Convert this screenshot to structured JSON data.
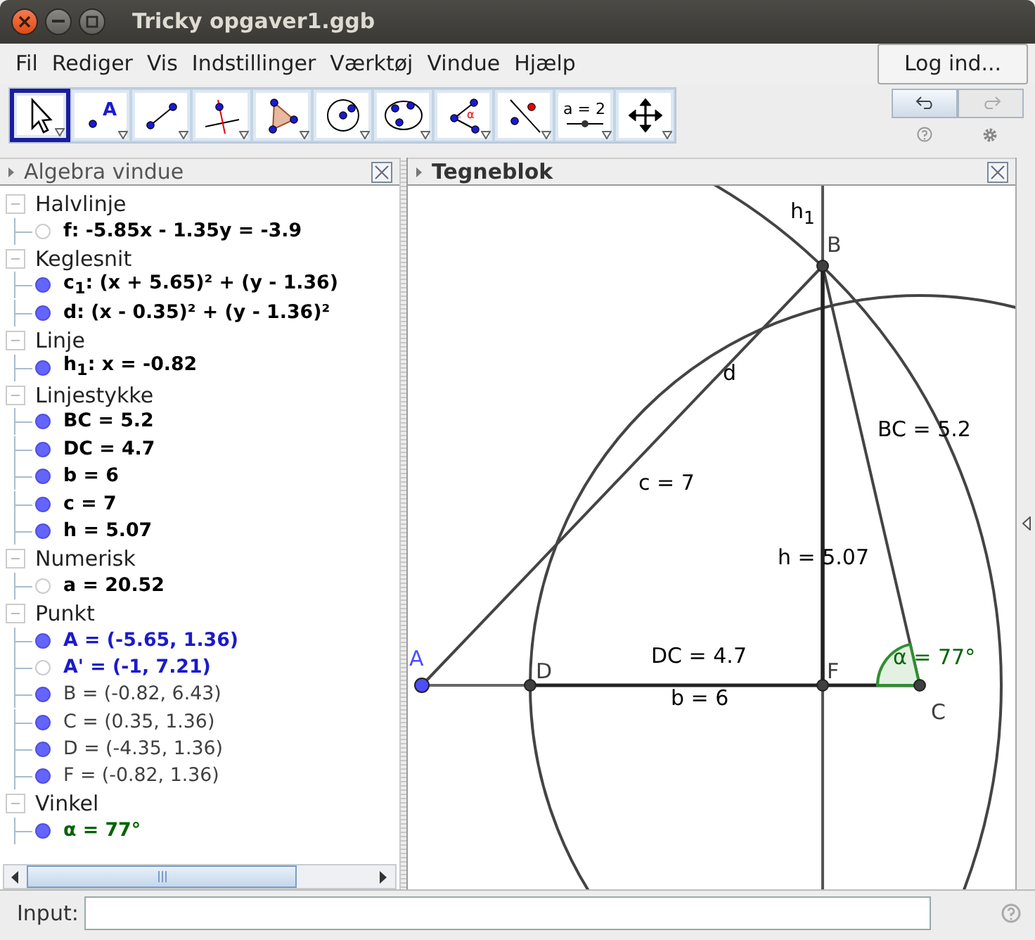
{
  "window": {
    "title": "Tricky opgaver1.ggb"
  },
  "menu": [
    "Fil",
    "Rediger",
    "Vis",
    "Indstillinger",
    "Værktøj",
    "Vindue",
    "Hjælp"
  ],
  "login": "Log ind...",
  "tools": [
    {
      "kind": "move",
      "selected": true
    },
    {
      "kind": "point",
      "selected": false,
      "text": "A"
    },
    {
      "kind": "segment",
      "selected": false
    },
    {
      "kind": "perpendicular",
      "selected": false
    },
    {
      "kind": "polygon",
      "selected": false
    },
    {
      "kind": "circle",
      "selected": false
    },
    {
      "kind": "conic",
      "selected": false
    },
    {
      "kind": "angle",
      "selected": false,
      "text": "α"
    },
    {
      "kind": "reflect",
      "selected": false
    },
    {
      "kind": "slider",
      "selected": false,
      "text": "a = 2"
    },
    {
      "kind": "move_view",
      "selected": false
    }
  ],
  "undo": {
    "disabled": false
  },
  "redo": {
    "disabled": true
  },
  "algebra": {
    "title": "Algebra vindue",
    "groups": [
      {
        "name": "Halvlinje",
        "expanded": true,
        "items": [
          {
            "text": "f: -5.85x - 1.35y = -3.9",
            "visible": false,
            "color": "#000000",
            "bold": true
          }
        ]
      },
      {
        "name": "Keglesnit",
        "expanded": true,
        "items": [
          {
            "text": "c$_{1}$: (x + 5.65)² + (y - 1.36)",
            "visible": true,
            "color": "#000000",
            "bold": true
          },
          {
            "text": "d: (x - 0.35)² + (y - 1.36)²",
            "visible": true,
            "color": "#000000",
            "bold": true
          }
        ]
      },
      {
        "name": "Linje",
        "expanded": true,
        "items": [
          {
            "text": "h$_{1}$: x = -0.82",
            "visible": true,
            "color": "#000000",
            "bold": true
          }
        ]
      },
      {
        "name": "Linjestykke",
        "expanded": true,
        "items": [
          {
            "text": "BC = 5.2",
            "visible": true,
            "color": "#000000",
            "bold": true
          },
          {
            "text": "DC = 4.7",
            "visible": true,
            "color": "#000000",
            "bold": true
          },
          {
            "text": "b = 6",
            "visible": true,
            "color": "#000000",
            "bold": true
          },
          {
            "text": "c = 7",
            "visible": true,
            "color": "#000000",
            "bold": true
          },
          {
            "text": "h = 5.07",
            "visible": true,
            "color": "#000000",
            "bold": true
          }
        ]
      },
      {
        "name": "Numerisk",
        "expanded": true,
        "items": [
          {
            "text": "a = 20.52",
            "visible": false,
            "color": "#000000",
            "bold": true
          }
        ]
      },
      {
        "name": "Punkt",
        "expanded": true,
        "items": [
          {
            "text": "A = (-5.65, 1.36)",
            "visible": true,
            "color": "#1a1acc",
            "bold": true
          },
          {
            "text": "A' = (-1, 7.21)",
            "visible": false,
            "color": "#1a1acc",
            "bold": true
          },
          {
            "text": "B = (-0.82, 6.43)",
            "visible": true,
            "color": "#404040",
            "bold": false
          },
          {
            "text": "C = (0.35, 1.36)",
            "visible": true,
            "color": "#404040",
            "bold": false
          },
          {
            "text": "D = (-4.35, 1.36)",
            "visible": true,
            "color": "#404040",
            "bold": false
          },
          {
            "text": "F = (-0.82, 1.36)",
            "visible": true,
            "color": "#404040",
            "bold": false
          }
        ]
      },
      {
        "name": "Vinkel",
        "expanded": true,
        "items": [
          {
            "text": "α = 77°",
            "visible": true,
            "color": "#006400",
            "bold": true
          }
        ]
      }
    ]
  },
  "graphics": {
    "title": "Tegneblok",
    "points": [
      {
        "label": "A",
        "color": "#4d4dff"
      },
      {
        "label": "D",
        "color": "#404040"
      },
      {
        "label": "F",
        "color": "#404040"
      },
      {
        "label": "C",
        "color": "#404040"
      },
      {
        "label": "B",
        "color": "#404040"
      }
    ],
    "labels": [
      {
        "text": "h$_{1}$",
        "color": "#000000"
      },
      {
        "text": "d",
        "color": "#000000"
      },
      {
        "text": "c = 7",
        "color": "#000000"
      },
      {
        "text": "BC = 5.2",
        "color": "#000000"
      },
      {
        "text": "h = 5.07",
        "color": "#000000"
      },
      {
        "text": "DC = 4.7",
        "color": "#000000"
      },
      {
        "text": "b = 6",
        "color": "#000000"
      },
      {
        "text": "α = 77°",
        "color": "#006400"
      }
    ]
  },
  "input": {
    "label": "Input:"
  }
}
